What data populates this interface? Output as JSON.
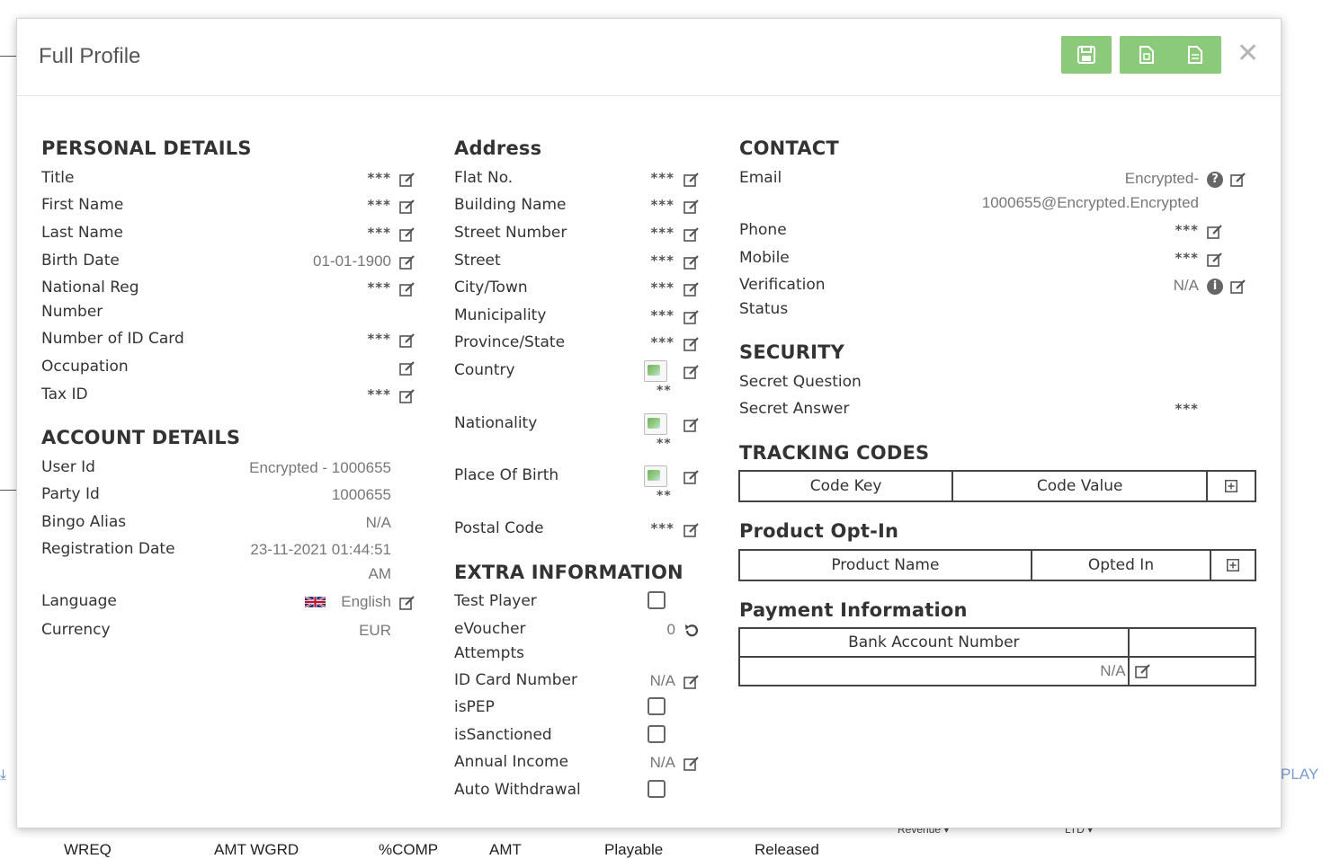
{
  "modal": {
    "title": "Full Profile"
  },
  "personal": {
    "heading": "PERSONAL DETAILS",
    "title_label": "Title",
    "title_value": "***",
    "first_name_label": "First Name",
    "first_name_value": "***",
    "last_name_label": "Last Name",
    "last_name_value": "***",
    "birth_date_label": "Birth Date",
    "birth_date_value": "01-01-1900",
    "national_reg_label_1": "National Reg",
    "national_reg_label_2": "Number",
    "national_reg_value": "***",
    "id_card_label": "Number of ID Card",
    "id_card_value": "***",
    "occupation_label": "Occupation",
    "tax_id_label": "Tax ID",
    "tax_id_value": "***"
  },
  "account": {
    "heading": "ACCOUNT DETAILS",
    "user_id_label": "User Id",
    "user_id_value": "Encrypted - 1000655",
    "party_id_label": "Party Id",
    "party_id_value": "1000655",
    "bingo_alias_label": "Bingo Alias",
    "bingo_alias_value": "N/A",
    "registration_label": "Registration Date",
    "registration_value_1": "23-11-2021 01:44:51",
    "registration_value_2": "AM",
    "language_label": "Language",
    "language_value": "English",
    "currency_label": "Currency",
    "currency_value": "EUR"
  },
  "address": {
    "heading": "Address",
    "flat_label": "Flat No.",
    "flat_value": "***",
    "building_label": "Building Name",
    "building_value": "***",
    "street_number_label": "Street Number",
    "street_number_value": "***",
    "street_label": "Street",
    "street_value": "***",
    "city_label": "City/Town",
    "city_value": "***",
    "municipality_label": "Municipality",
    "municipality_value": "***",
    "province_label": "Province/State",
    "province_value": "***",
    "country_label": "Country",
    "country_value": "**",
    "nationality_label": "Nationality",
    "nationality_value": "**",
    "place_of_birth_label": "Place Of Birth",
    "place_of_birth_value": "**",
    "postal_code_label": "Postal Code",
    "postal_code_value": "***"
  },
  "extra": {
    "heading": "EXTRA INFORMATION",
    "test_player_label": "Test Player",
    "evoucher_label_1": "eVoucher",
    "evoucher_label_2": "Attempts",
    "evoucher_value": "0",
    "id_card_number_label": "ID Card Number",
    "id_card_number_value": "N/A",
    "ispep_label": "isPEP",
    "issanctioned_label": "isSanctioned",
    "annual_income_label": "Annual Income",
    "annual_income_value": "N/A",
    "auto_withdrawal_label": "Auto Withdrawal"
  },
  "contact": {
    "heading": "CONTACT",
    "email_label": "Email",
    "email_value_1": "Encrypted-",
    "email_value_2": "1000655@Encrypted.Encrypted",
    "phone_label": "Phone",
    "phone_value": "***",
    "mobile_label": "Mobile",
    "mobile_value": "***",
    "verification_label_1": "Verification",
    "verification_label_2": "Status",
    "verification_value": "N/A"
  },
  "security": {
    "heading": "SECURITY",
    "question_label": "Secret Question",
    "answer_label": "Secret Answer",
    "answer_value": "***"
  },
  "tracking": {
    "heading": "TRACKING CODES",
    "col_key": "Code Key",
    "col_value": "Code Value"
  },
  "optin": {
    "heading": "Product Opt-In",
    "col_name": "Product Name",
    "col_opted": "Opted In"
  },
  "payment": {
    "heading": "Payment Information",
    "col_bank": "Bank Account Number",
    "row_value": "N/A"
  },
  "background": {
    "play_link": "PLAY",
    "revenue_label": "Revenue",
    "ltd_label": "LTD",
    "columns": [
      "WREQ",
      "AMT WGRD",
      "%COMP",
      "AMT",
      "Playable",
      "Released"
    ]
  },
  "colors": {
    "header_button": "#8bc97b",
    "link_blue": "#7a9bd1"
  }
}
